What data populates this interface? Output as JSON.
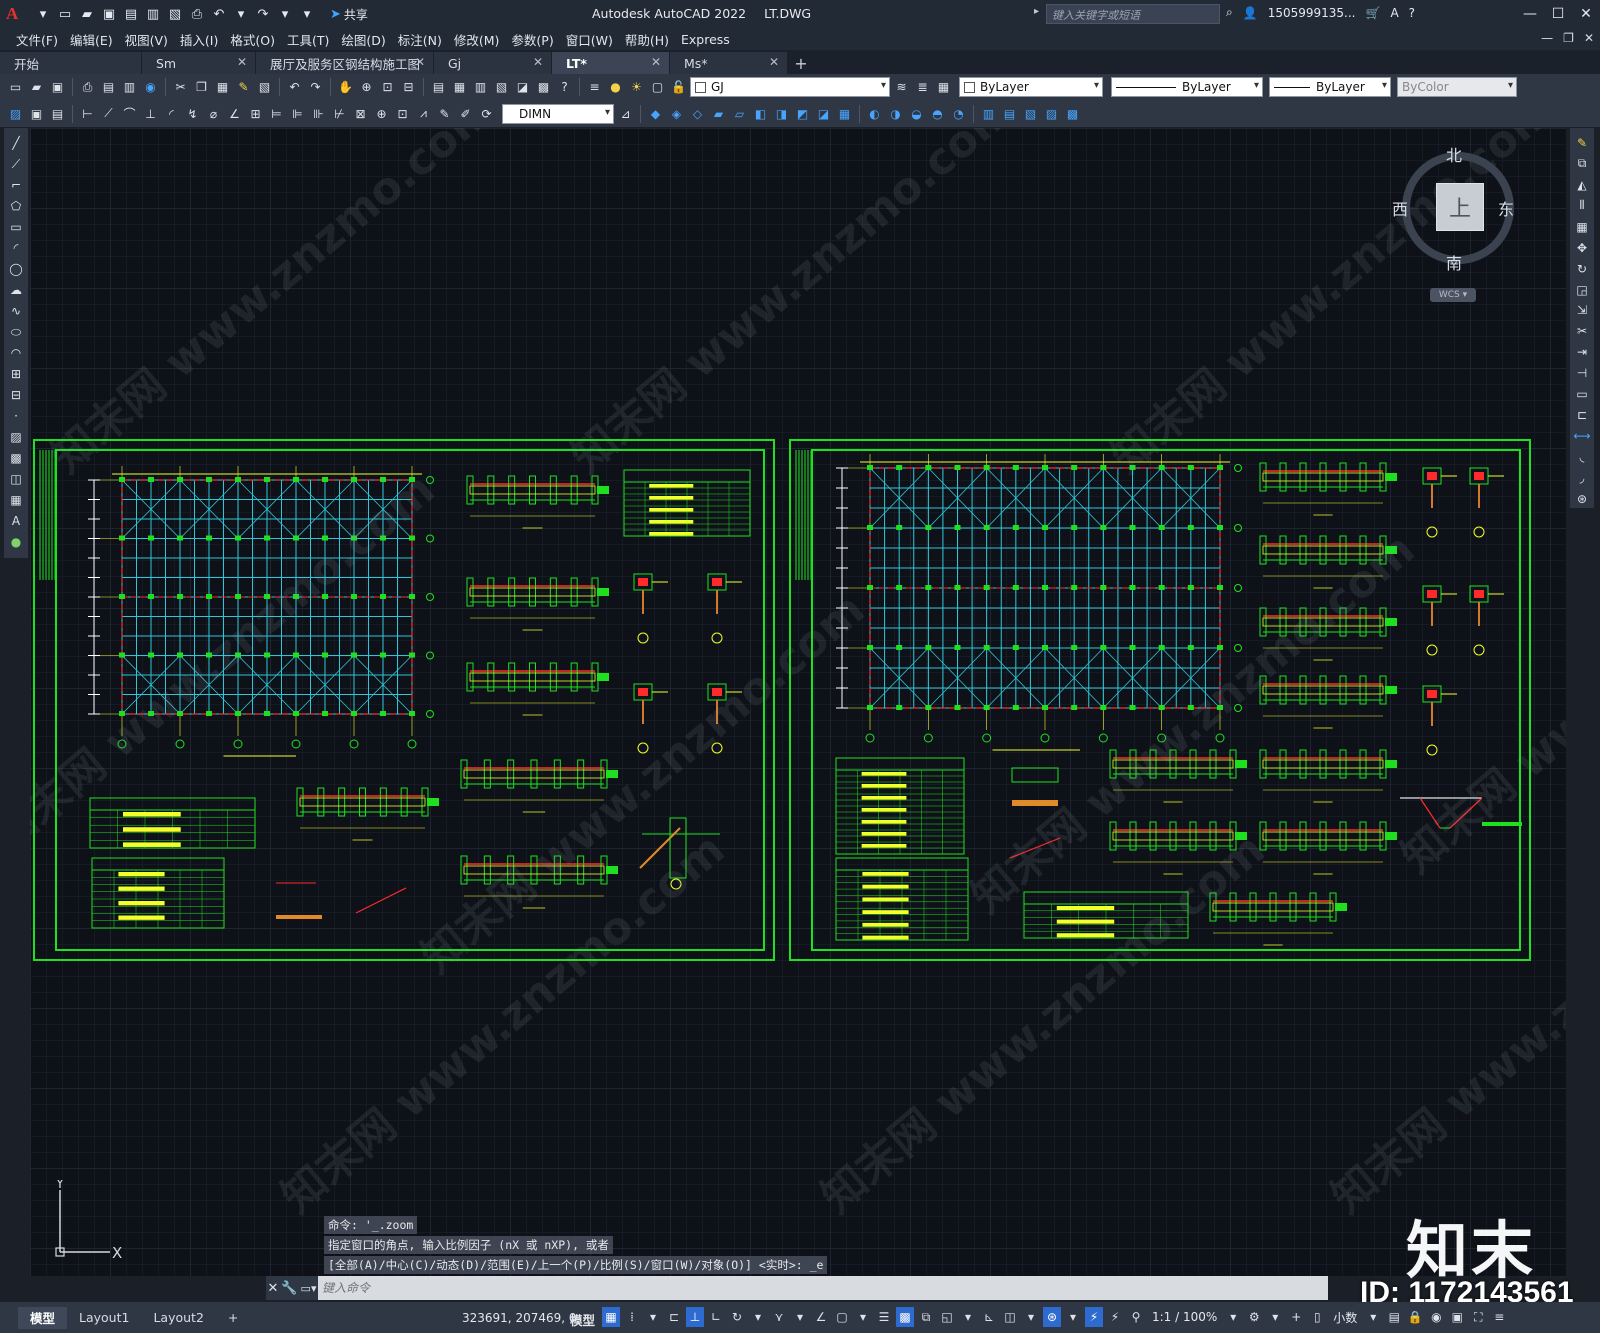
{
  "titlebar": {
    "app_logo": "A",
    "share_label": "共享",
    "app_name": "Autodesk AutoCAD 2022",
    "file_name": "LT.DWG",
    "search_placeholder": "键入关键字或短语",
    "user": "1505999135...",
    "icons": [
      "new-icon",
      "open-icon",
      "save-icon",
      "saveas-icon",
      "plot-icon",
      "undo-icon",
      "redo-icon"
    ]
  },
  "menubar": {
    "items": [
      "文件(F)",
      "编辑(E)",
      "视图(V)",
      "插入(I)",
      "格式(O)",
      "工具(T)",
      "绘图(D)",
      "标注(N)",
      "修改(M)",
      "参数(P)",
      "窗口(W)",
      "帮助(H)",
      "Express"
    ]
  },
  "tabs": [
    {
      "label": "开始",
      "active": false
    },
    {
      "label": "Sm",
      "active": false
    },
    {
      "label": "展厅及服务区钢结构施工图",
      "active": false
    },
    {
      "label": "Gj",
      "active": false
    },
    {
      "label": "LT*",
      "active": true
    },
    {
      "label": "Ms*",
      "active": false
    }
  ],
  "toolbar1": {
    "layer_name": "GJ",
    "color": "ByLayer",
    "linetype": "ByLayer",
    "lineweight": "ByLayer",
    "plotstyle": "ByColor"
  },
  "toolbar2": {
    "dimstyle": "DIMN"
  },
  "viewcube": {
    "north": "北",
    "south": "南",
    "east": "东",
    "west": "西",
    "face": "上",
    "wcs": "WCS"
  },
  "watermark_text": "知末网 www.znzmo.com",
  "ucs": {
    "x_label": "X",
    "y_label": "Y"
  },
  "command": {
    "history": [
      "命令: '_.zoom",
      "指定窗口的角点, 输入比例因子 (nX 或 nXP), 或者",
      "[全部(A)/中心(C)/动态(D)/范围(E)/上一个(P)/比例(S)/窗口(W)/对象(O)] <实时>: _e"
    ],
    "placeholder": "键入命令"
  },
  "brand": {
    "logo_text": "知末",
    "id_text": "ID: 1172143561"
  },
  "status": {
    "layout_tabs": [
      "模型",
      "Layout1",
      "Layout2"
    ],
    "coords": "323691, 207469, 0",
    "space": "模型",
    "scale": "1:1 / 100%",
    "units": "小数"
  },
  "colors": {
    "frame_green": "#1fe01f",
    "grid_cyan": "#2ec7d8",
    "dim_yellow": "#f2ff2a",
    "axis_red": "#ff2a2a"
  }
}
